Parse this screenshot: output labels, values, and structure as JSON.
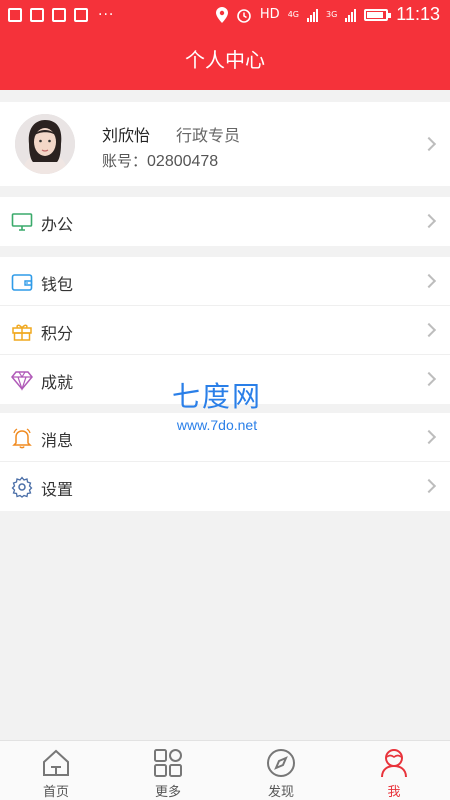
{
  "status_bar": {
    "network": "HD",
    "network_a": "4G",
    "network_b": "3G",
    "time": "11:13"
  },
  "header": {
    "title": "个人中心"
  },
  "profile": {
    "name": "刘欣怡",
    "role": "行政专员",
    "account_label": "账号：",
    "account_number": "02800478"
  },
  "groups": [
    {
      "items": [
        {
          "label": "办公",
          "icon": "monitor-icon"
        }
      ]
    },
    {
      "items": [
        {
          "label": "钱包",
          "icon": "wallet-icon"
        },
        {
          "label": "积分",
          "icon": "gift-icon"
        },
        {
          "label": "成就",
          "icon": "diamond-icon"
        }
      ]
    },
    {
      "items": [
        {
          "label": "消息",
          "icon": "bell-icon"
        },
        {
          "label": "设置",
          "icon": "gear-icon"
        }
      ]
    }
  ],
  "watermark": {
    "title": "七度网",
    "url": "www.7do.net"
  },
  "bottom_nav": {
    "active": "我",
    "tabs": [
      {
        "label": "首页",
        "icon": "home-icon"
      },
      {
        "label": "更多",
        "icon": "grid-icon"
      },
      {
        "label": "发现",
        "icon": "compass-icon"
      },
      {
        "label": "我",
        "icon": "user-icon"
      }
    ]
  },
  "colors": {
    "brand": "#f5323a",
    "active_tab": "#e8333b",
    "watermark": "#2a7fe8"
  }
}
